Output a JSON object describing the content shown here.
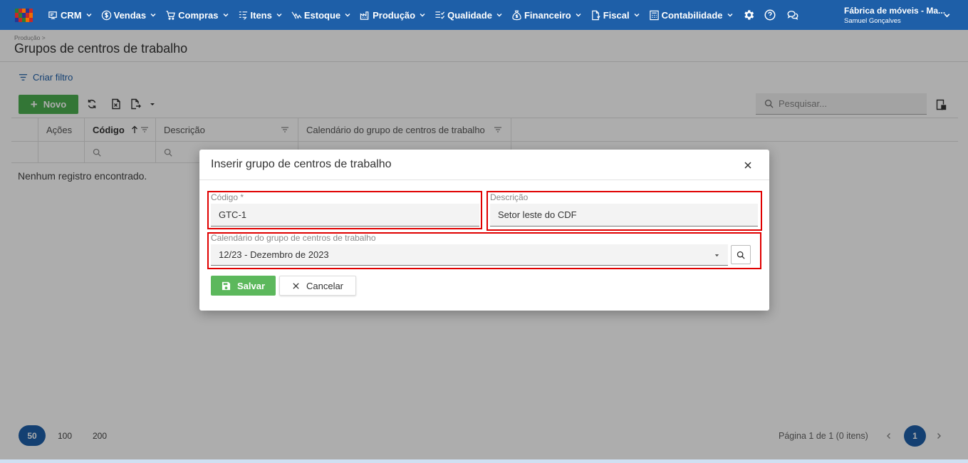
{
  "colors": {
    "topbar": "#1e5fa8",
    "primary": "#1e5fa8",
    "new_button": "#4caf50",
    "save_button": "#5cb85c",
    "highlight": "#e00000"
  },
  "topbar": {
    "menu": [
      {
        "label": "CRM",
        "icon": "crm-icon"
      },
      {
        "label": "Vendas",
        "icon": "dollar-icon"
      },
      {
        "label": "Compras",
        "icon": "cart-icon"
      },
      {
        "label": "Itens",
        "icon": "items-icon"
      },
      {
        "label": "Estoque",
        "icon": "stock-icon"
      },
      {
        "label": "Produção",
        "icon": "factory-icon"
      },
      {
        "label": "Qualidade",
        "icon": "quality-icon"
      },
      {
        "label": "Financeiro",
        "icon": "money-bag-icon"
      },
      {
        "label": "Fiscal",
        "icon": "fiscal-doc-icon"
      },
      {
        "label": "Contabilidade",
        "icon": "calculator-icon"
      }
    ],
    "company_name": "Fábrica de móveis - Ma...",
    "user_name": "Samuel Gonçalves"
  },
  "page": {
    "breadcrumb": "Produção >",
    "title": "Grupos de centros de trabalho",
    "create_filter": "Criar filtro",
    "new_label": "Novo",
    "search_placeholder": "Pesquisar...",
    "empty_message": "Nenhum registro encontrado."
  },
  "table": {
    "columns": [
      "Ações",
      "Código",
      "Descrição",
      "Calendário do grupo de centros de trabalho"
    ]
  },
  "footer": {
    "page_sizes": [
      "50",
      "100",
      "200"
    ],
    "page_info": "Página 1 de 1 (0 itens)",
    "current_page": "1"
  },
  "dialog": {
    "title": "Inserir grupo de centros de trabalho",
    "codigo_label": "Código *",
    "codigo_value": "GTC-1",
    "descricao_label": "Descrição",
    "descricao_value": "Setor leste do CDF",
    "calendario_label": "Calendário do grupo de centros de trabalho",
    "calendario_value": "12/23 - Dezembro de 2023",
    "save_label": "Salvar",
    "cancel_label": "Cancelar"
  }
}
